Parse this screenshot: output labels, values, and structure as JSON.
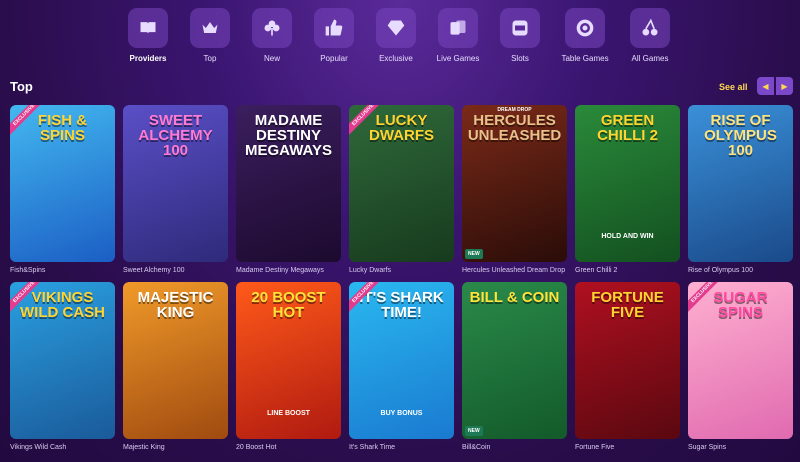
{
  "nav": {
    "items": [
      {
        "label": "Providers",
        "icon": "book-icon",
        "active": true
      },
      {
        "label": "Top",
        "icon": "crown-icon"
      },
      {
        "label": "New",
        "icon": "clover-icon"
      },
      {
        "label": "Popular",
        "icon": "thumbs-up-icon"
      },
      {
        "label": "Exclusive",
        "icon": "diamond-icon"
      },
      {
        "label": "Live Games",
        "icon": "cards-icon"
      },
      {
        "label": "Slots",
        "icon": "slot-machine-icon"
      },
      {
        "label": "Table Games",
        "icon": "chip-icon"
      },
      {
        "label": "All Games",
        "icon": "cherries-icon"
      }
    ]
  },
  "section": {
    "title": "Top",
    "see_all": "See all",
    "prev_icon": "chevron-left-icon",
    "next_icon": "chevron-right-icon"
  },
  "badges": {
    "exclusive": "EXCLUSIVE",
    "new": "NEW"
  },
  "games": [
    {
      "name": "Fish&Spins",
      "art_title": "FISH & SPINS",
      "exclusive": true,
      "colors": [
        "#43b8f0",
        "#1b5ec4"
      ],
      "title_color": "#ffd431"
    },
    {
      "name": "Sweet Alchemy 100",
      "art_title": "SWEET ALCHEMY 100",
      "colors": [
        "#5a4fc7",
        "#2f2a7a"
      ],
      "title_color": "#ff7ad1"
    },
    {
      "name": "Madame Destiny Megaways",
      "art_title": "MADAME DESTINY MEGAWAYS",
      "colors": [
        "#3b1e5e",
        "#1c0a2e"
      ],
      "title_color": "#ffffff"
    },
    {
      "name": "Lucky Dwarfs",
      "art_title": "LUCKY DWARFS",
      "exclusive": true,
      "colors": [
        "#2f6a3a",
        "#173a1e"
      ],
      "title_color": "#ffd431"
    },
    {
      "name": "Hercules Unleashed Dream Drop",
      "art_title": "HERCULES UNLEASHED",
      "provider": "DREAM DROP",
      "new": true,
      "colors": [
        "#7a2a18",
        "#2a0c08"
      ],
      "title_color": "#e8c08a"
    },
    {
      "name": "Green Chilli 2",
      "art_title": "GREEN CHILLI 2",
      "subtitle": "HOLD AND WIN",
      "colors": [
        "#2a8a3a",
        "#135020"
      ],
      "title_color": "#ffd431"
    },
    {
      "name": "Rise of Olympus 100",
      "art_title": "RISE OF OLYMPUS 100",
      "colors": [
        "#3a90d8",
        "#1a4a8a"
      ],
      "title_color": "#ffe27a"
    },
    {
      "name": "Vikings Wild Cash",
      "art_title": "VIKINGS WILD CASH",
      "exclusive": true,
      "colors": [
        "#2aa0e0",
        "#1a5a9a"
      ],
      "title_color": "#ffd431"
    },
    {
      "name": "Majestic King",
      "art_title": "MAJESTIC KING",
      "colors": [
        "#f09a2a",
        "#a04a10"
      ],
      "title_color": "#ffffff"
    },
    {
      "name": "20 Boost Hot",
      "art_title": "20 BOOST HOT",
      "subtitle": "LINE BOOST",
      "colors": [
        "#ff5a1a",
        "#b01a10"
      ],
      "title_color": "#ffe23a"
    },
    {
      "name": "It's Shark Time",
      "art_title": "IT'S SHARK TIME!",
      "subtitle": "BUY BONUS",
      "exclusive": true,
      "colors": [
        "#2ab8f0",
        "#1a7ad0"
      ],
      "title_color": "#ffffff"
    },
    {
      "name": "Bill&Coin",
      "art_title": "BILL & COIN",
      "new": true,
      "colors": [
        "#2a8a4a",
        "#135a2a"
      ],
      "title_color": "#ffe23a"
    },
    {
      "name": "Fortune Five",
      "art_title": "FORTUNE FIVE",
      "colors": [
        "#b01020",
        "#5a0810"
      ],
      "title_color": "#ffd431"
    },
    {
      "name": "Sugar Spins",
      "art_title": "SUGAR SPINS",
      "exclusive": true,
      "colors": [
        "#ffb0d0",
        "#e06ab0"
      ],
      "title_color": "#ff4aa0"
    }
  ]
}
